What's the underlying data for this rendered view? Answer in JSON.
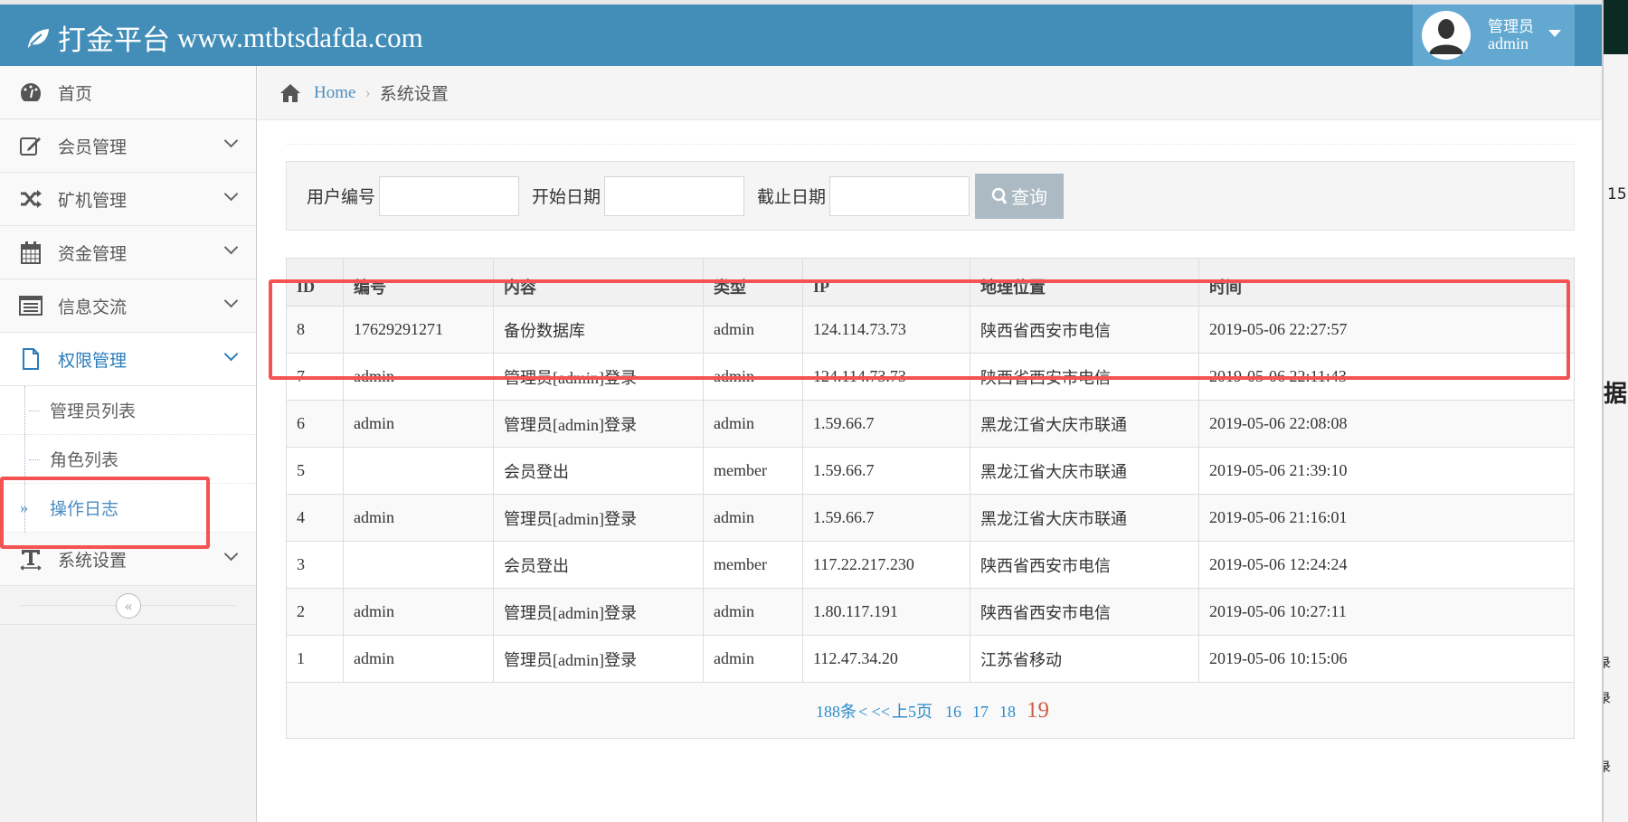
{
  "header": {
    "logo_cn": "打金平台",
    "logo_url": "www.mtbtsdafda.com",
    "user_role": "管理员",
    "user_name": "admin"
  },
  "sidebar": {
    "items": [
      {
        "label": "首页",
        "icon": "dashboard-icon"
      },
      {
        "label": "会员管理",
        "icon": "edit-icon"
      },
      {
        "label": "矿机管理",
        "icon": "shuffle-icon"
      },
      {
        "label": "资金管理",
        "icon": "calendar-icon"
      },
      {
        "label": "信息交流",
        "icon": "list-icon"
      },
      {
        "label": "权限管理",
        "icon": "file-icon"
      }
    ],
    "subitems": [
      "管理员列表",
      "角色列表",
      "操作日志"
    ],
    "last": {
      "label": "系统设置",
      "icon": "text-icon"
    }
  },
  "breadcrumb": {
    "home": "Home",
    "current": "系统设置"
  },
  "search": {
    "user_label": "用户编号",
    "start_label": "开始日期",
    "end_label": "截止日期",
    "button": "查询",
    "user_value": "",
    "start_value": "",
    "end_value": ""
  },
  "table": {
    "headers": [
      "ID",
      "编号",
      "内容",
      "类型",
      "IP",
      "地理位置",
      "时间"
    ],
    "rows": [
      [
        "8",
        "17629291271",
        "备份数据库",
        "admin",
        "124.114.73.73",
        "陕西省西安市电信",
        "2019-05-06 22:27:57"
      ],
      [
        "7",
        "admin",
        "管理员[admin]登录",
        "admin",
        "124.114.73.73",
        "陕西省西安市电信",
        "2019-05-06 22:11:43"
      ],
      [
        "6",
        "admin",
        "管理员[admin]登录",
        "admin",
        "1.59.66.7",
        "黑龙江省大庆市联通",
        "2019-05-06 22:08:08"
      ],
      [
        "5",
        "",
        "会员登出",
        "member",
        "1.59.66.7",
        "黑龙江省大庆市联通",
        "2019-05-06 21:39:10"
      ],
      [
        "4",
        "admin",
        "管理员[admin]登录",
        "admin",
        "1.59.66.7",
        "黑龙江省大庆市联通",
        "2019-05-06 21:16:01"
      ],
      [
        "3",
        "",
        "会员登出",
        "member",
        "117.22.217.230",
        "陕西省西安市电信",
        "2019-05-06 12:24:24"
      ],
      [
        "2",
        "admin",
        "管理员[admin]登录",
        "admin",
        "1.80.117.191",
        "陕西省西安市电信",
        "2019-05-06 10:27:11"
      ],
      [
        "1",
        "admin",
        "管理员[admin]登录",
        "admin",
        "112.47.34.20",
        "江苏省移动",
        "2019-05-06 10:15:06"
      ]
    ]
  },
  "pagination": {
    "total": "188条",
    "prev": "< <<",
    "prev5": "上5页",
    "pages": [
      "16",
      "17",
      "18"
    ],
    "current": "19"
  },
  "background_window": {
    "fragments": [
      "15",
      "据",
      "录",
      "录",
      "录"
    ]
  },
  "colors": {
    "header": "#438eb9",
    "accent": "#2b7dbc",
    "highlight": "#f55252",
    "current_page": "#d15b47"
  }
}
